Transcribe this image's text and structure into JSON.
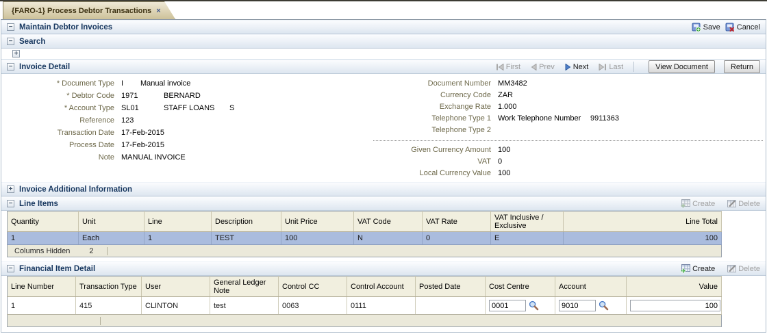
{
  "tab": {
    "title": "{FARO-1} Process Debtor Transactions",
    "close_glyph": "×"
  },
  "icons": {
    "collapse_glyph": "−",
    "expand_glyph": "+"
  },
  "toolbar": {
    "save_label": "Save",
    "cancel_label": "Cancel"
  },
  "sections": {
    "maintain": {
      "title": "Maintain Debtor Invoices"
    },
    "search": {
      "title": "Search"
    },
    "invoice_detail": {
      "title": "Invoice Detail"
    },
    "invoice_additional": {
      "title": "Invoice Additional Information"
    },
    "line_items": {
      "title": "Line Items"
    },
    "financial_detail": {
      "title": "Financial Item Detail"
    }
  },
  "nav": {
    "first": "First",
    "prev": "Prev",
    "next": "Next",
    "last": "Last",
    "view_document": "View Document",
    "return": "Return"
  },
  "table_actions": {
    "create_label": "Create",
    "delete_label": "Delete"
  },
  "invoice_form": {
    "left": [
      {
        "label": "* Document Type",
        "value": "I",
        "value2": "Manual invoice"
      },
      {
        "label": "* Debtor Code",
        "value": "1971",
        "value2": "BERNARD"
      },
      {
        "label": "* Account Type",
        "value": "SL01",
        "value2": "STAFF LOANS",
        "value3": "S"
      },
      {
        "label": "Reference",
        "value": "123"
      },
      {
        "label": "Transaction Date",
        "value": "17-Feb-2015"
      },
      {
        "label": "Process Date",
        "value": "17-Feb-2015"
      },
      {
        "label": "Note",
        "value": "MANUAL INVOICE"
      }
    ],
    "right_top": [
      {
        "label": "Document Number",
        "value": "MM3482"
      },
      {
        "label": "Currency Code",
        "value": "ZAR"
      },
      {
        "label": "Exchange Rate",
        "value": "1.000"
      },
      {
        "label": "Telephone Type 1",
        "value": "Work Telephone Number",
        "value2": "9911363"
      },
      {
        "label": "Telephone Type 2",
        "value": ""
      }
    ],
    "right_bottom": [
      {
        "label": "Given Currency Amount",
        "value": "100"
      },
      {
        "label": "VAT",
        "value": "0"
      },
      {
        "label": "Local Currency Value",
        "value": "100"
      }
    ]
  },
  "line_items": {
    "columns": [
      "Quantity",
      "Unit",
      "Line",
      "Description",
      "Unit Price",
      "VAT Code",
      "VAT Rate",
      "VAT Inclusive / Exclusive",
      "Line Total"
    ],
    "rows": [
      {
        "quantity": "1",
        "unit": "Each",
        "line": "1",
        "description": "TEST",
        "unit_price": "100",
        "vat_code": "N",
        "vat_rate": "0",
        "vat_incl": "E",
        "line_total": "100"
      }
    ],
    "footer_label": "Columns Hidden",
    "footer_value": "2"
  },
  "financial_detail": {
    "columns": [
      "Line Number",
      "Transaction Type",
      "User",
      "General Ledger Note",
      "Control CC",
      "Control Account",
      "Posted Date",
      "Cost Centre",
      "Account",
      "Value"
    ],
    "rows": [
      {
        "line_number": "1",
        "transaction_type": "415",
        "user": "CLINTON",
        "gl_note": "test",
        "control_cc": "0063",
        "control_account": "0111",
        "posted_date": "",
        "cost_centre_value": "0001",
        "account_value": "9010",
        "value": "100"
      }
    ]
  },
  "colors": {
    "accent_header_text": "#17375f",
    "label_brown": "#6c6748",
    "selected_row": "#aabcde",
    "table_header_bg": "#f1efdf",
    "tab_bg": "#cdc199"
  }
}
